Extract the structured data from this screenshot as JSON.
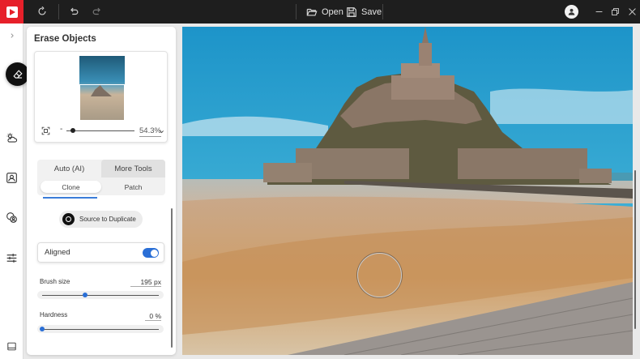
{
  "toolbar": {
    "open_label": "Open",
    "save_label": "Save"
  },
  "panel": {
    "title": "Erase Objects",
    "zoom_value": "54.3%",
    "mode_tabs": [
      {
        "label": "Auto (AI)",
        "active": false
      },
      {
        "label": "More Tools",
        "active": true
      }
    ],
    "sub_tabs": [
      {
        "label": "Clone",
        "active": true
      },
      {
        "label": "Patch",
        "active": false
      }
    ],
    "source_button_label": "Source to Duplicate",
    "aligned": {
      "label": "Aligned",
      "enabled": true
    },
    "brush_size": {
      "label": "Brush size",
      "value": "195",
      "unit": "px",
      "fraction": 0.37
    },
    "hardness": {
      "label": "Hardness",
      "value": "0",
      "unit": "%",
      "fraction": 0.0
    }
  },
  "colors": {
    "topbar": "#1e1e1e",
    "brand": "#e6202a",
    "accent": "#2a6fd6"
  },
  "icons": {
    "topbar": [
      "app-logo-icon",
      "refresh-icon",
      "undo-icon",
      "redo-icon",
      "folder-open-icon",
      "save-icon",
      "user-icon",
      "minimize-icon",
      "restore-icon",
      "close-icon"
    ],
    "rail": [
      "expand-chevron-icon",
      "eraser-icon",
      "weather-sky-icon",
      "portrait-icon",
      "face-swap-icon",
      "sliders-icon",
      "gallery-icon"
    ]
  }
}
